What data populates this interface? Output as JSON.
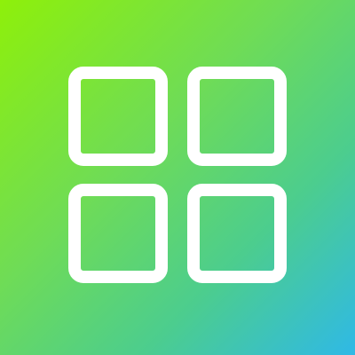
{
  "icon": {
    "name": "grid-icon",
    "background_gradient": [
      "#8ef00a",
      "#6fdc56",
      "#4ccd8e",
      "#2fb9e6"
    ],
    "stroke_color": "#ffffff",
    "squares": [
      "top-left",
      "top-right",
      "bottom-left",
      "bottom-right"
    ]
  }
}
